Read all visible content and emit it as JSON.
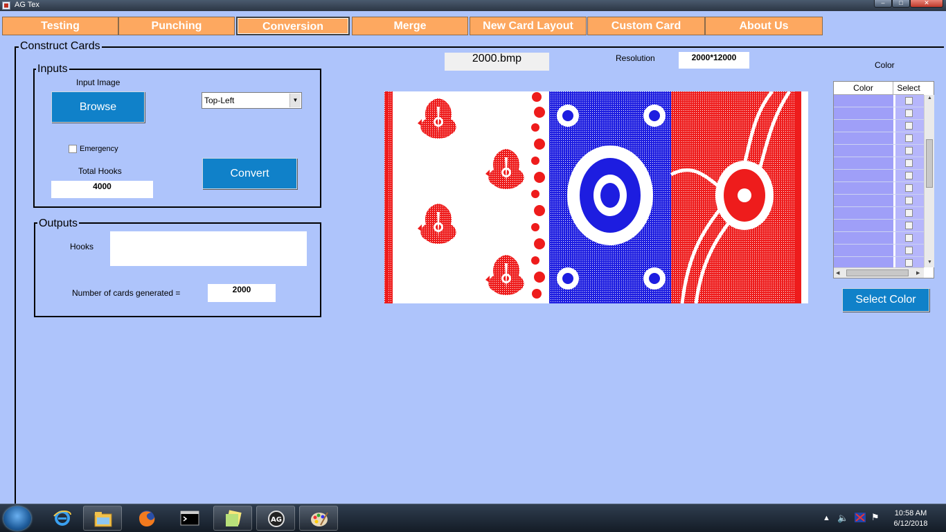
{
  "window": {
    "title": "AG Tex"
  },
  "tabs": [
    {
      "label": "Testing",
      "active": false
    },
    {
      "label": "Punching",
      "active": false
    },
    {
      "label": "Conversion",
      "active": true
    },
    {
      "label": "Merge",
      "active": false
    },
    {
      "label": "New Card Layout",
      "active": false
    },
    {
      "label": "Custom Card",
      "active": false
    },
    {
      "label": "About Us",
      "active": false
    }
  ],
  "construct": {
    "title": "Construct Cards",
    "inputs": {
      "title": "Inputs",
      "input_image_label": "Input Image",
      "browse_label": "Browse",
      "position_selected": "Top-Left",
      "emergency_label": "Emergency",
      "emergency_checked": false,
      "total_hooks_label": "Total Hooks",
      "total_hooks_value": "4000",
      "convert_label": "Convert"
    },
    "outputs": {
      "title": "Outputs",
      "hooks_label": "Hooks",
      "hooks_value": "",
      "cards_label": "Number of cards generated =",
      "cards_value": "2000"
    },
    "file_name": "2000.bmp",
    "resolution_label": "Resolution",
    "resolution_value": "2000*12000",
    "color_label": "Color",
    "color_table": {
      "headers": [
        "Color",
        "Select"
      ],
      "rows": 14
    },
    "select_color_label": "Select Color"
  },
  "palette": {
    "background": "#aec4fb",
    "tab_orange": "#fda860",
    "button_blue": "#1081c9",
    "design_red": "#ee1c1c",
    "design_blue": "#1d1de0",
    "swatch_purple": "#9f9ff8"
  },
  "taskbar": {
    "apps": [
      "internet-explorer-icon",
      "file-explorer-icon",
      "firefox-icon",
      "command-prompt-icon",
      "sticky-notes-icon",
      "ag-tex-icon",
      "paint-icon"
    ],
    "time": "10:58 AM",
    "date": "6/12/2018"
  }
}
